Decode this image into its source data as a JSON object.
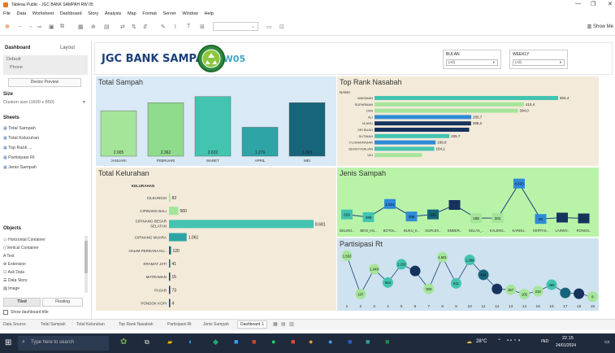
{
  "window": {
    "title": "Tableau Public - JGC BANK SAMPAH RW 05",
    "controls": [
      "—",
      "❐",
      "✕"
    ]
  },
  "menu": [
    "File",
    "Data",
    "Worksheet",
    "Dashboard",
    "Story",
    "Analysis",
    "Map",
    "Format",
    "Server",
    "Window",
    "Help"
  ],
  "toolbar": {
    "show_me": "Show Me"
  },
  "left": {
    "tab_dashboard": "Dashboard",
    "tab_layout": "Layout",
    "device_default": "Default",
    "device_phone": "Phone",
    "device_preview": "Device Preview",
    "size_heading": "Size",
    "size_value": "Custom size (1600 x 850)",
    "sheets_heading": "Sheets",
    "sheets": [
      "Total Sampah",
      "Total Keluruhan",
      "Top Rank ...",
      "Partisipasi Rt",
      "Jenis Sampah"
    ],
    "objects_heading": "Objects",
    "objects": [
      "Horizontal Container",
      "Vertical Container",
      "Text",
      "Extension",
      "Ask Data",
      "Data Story",
      "Image"
    ],
    "tiled": "Tiled",
    "floating": "Floating",
    "show_title": "Show dashboard title"
  },
  "dashboard": {
    "title": "JGC BANK SAMPAH",
    "title_suffix": "RW05",
    "filters": [
      {
        "label": "BULAN",
        "value": "(All)"
      },
      {
        "label": "WEEKLY",
        "value": "(All)"
      }
    ]
  },
  "colors": {
    "teal_dark": "#17657b",
    "teal": "#43c4b0",
    "green_light": "#a5e59a",
    "navy": "#16335e",
    "blue": "#2e8bd6",
    "panel_blue": "#d9e9f5",
    "panel_tan": "#f3ead9",
    "panel_green": "#b9f3a8",
    "panel_ltblue": "#cfe2ef"
  },
  "chart_data": [
    {
      "id": "total_sampah",
      "type": "bar",
      "title": "Total Sampah",
      "categories": [
        "JANUARI",
        "FEBRUARI",
        "MARET",
        "APRIL",
        "MEI"
      ],
      "values": [
        2005,
        2362,
        2632,
        1276,
        2363
      ],
      "labels": [
        "2.005",
        "2.362",
        "2.632",
        "1.276",
        "2.363"
      ],
      "colors": [
        "#a5e59a",
        "#8fdc8c",
        "#43c4b0",
        "#2ea4a6",
        "#17657b"
      ]
    },
    {
      "id": "top_rank",
      "type": "bar",
      "orientation": "horizontal",
      "title": "Top Rank Nasabah",
      "dimension_label": "NAMA",
      "categories": [
        "WAKIMAN",
        "SUPARMAN",
        "DWI",
        "ALI",
        "M.ARU",
        "SRI BUAH",
        "SUTINAH",
        "FLORIA/PASAR",
        "DENSY/GALIAN",
        "UKI"
      ],
      "values": [
        504.4,
        410.4,
        394.0,
        265.7,
        265.2,
        260.0,
        205.7,
        168.0,
        164.1,
        130.0
      ],
      "labels": [
        "504,4",
        "410,4",
        "394,0",
        "265,7",
        "265,2",
        "",
        "205,7",
        "168,0",
        "164,1",
        ""
      ],
      "colors": [
        "#43c4b0",
        "#a5e59a",
        "#a5e59a",
        "#2e8bd6",
        "#16335e",
        "#16335e",
        "#43c4b0",
        "#2e8bd6",
        "#43c4b0",
        "#a5e59a"
      ]
    },
    {
      "id": "total_kelurahan",
      "type": "bar",
      "orientation": "horizontal",
      "title": "Total Kelurahan",
      "dimension_label": "KELURAHAN",
      "categories": [
        "CILEUNGSI",
        "CIPINANG BALI",
        "CIPINANG BESAR SELATAN",
        "CIPINANG MUARA",
        "HALIM PERDANA KU..",
        "KRAMAT JATI",
        "MATRAMAN",
        "PASAR",
        "PONDOK KOPI"
      ],
      "values": [
        82,
        560,
        8681,
        1061,
        120,
        41,
        15,
        73,
        4
      ],
      "labels": [
        "82",
        "560",
        "8.681",
        "1.061",
        "120",
        "41",
        "15",
        "73",
        "4"
      ],
      "colors": [
        "#a5e59a",
        "#a5e59a",
        "#43c4b0",
        "#2ea4a6",
        "#17657b",
        "#17657b",
        "#16335e",
        "#16335e",
        "#16335e"
      ]
    },
    {
      "id": "jenis_sampah",
      "type": "line",
      "title": "Jenis Sampah",
      "categories": [
        "BELING..",
        "BESI_KG..",
        "BOTOL..",
        "BUKU_K..",
        "DUPLEX..",
        "EMBER..",
        "GELAS_..",
        "KALENG..",
        "KARDU..",
        "KERTAS..",
        "LAINNY..",
        "RONGS.."
      ],
      "values": [
        629,
        299,
        1924,
        388,
        636,
        1800,
        188,
        201,
        4433,
        80,
        250,
        150
      ],
      "labels": [
        "629",
        "299",
        "1.924",
        "388",
        "636",
        "",
        "188",
        "201",
        "4.433",
        "80",
        "",
        ""
      ],
      "colors": [
        "#43c4b0",
        "#43c4b0",
        "#2e8bd6",
        "#2e8bd6",
        "#17657b",
        "#16335e",
        "#a5e59a",
        "#a5e59a",
        "#2e8bd6",
        "#2e8bd6",
        "#16335e",
        "#16335e"
      ]
    },
    {
      "id": "partisipasi_rt",
      "type": "line",
      "title": "Partisipasi Rt",
      "categories": [
        "1",
        "2",
        "3",
        "4",
        "5",
        "6",
        "7",
        "8",
        "9",
        "10",
        "11",
        "12",
        "13",
        "14",
        "15",
        "16",
        "17",
        "18",
        "19"
      ],
      "values": [
        1553,
        107,
        1049,
        544,
        1233,
        980,
        303,
        1501,
        511,
        1399,
        834,
        300,
        267,
        105,
        216,
        460,
        150,
        120,
        8
      ],
      "labels": [
        "1.553",
        "107",
        "1.049",
        "544",
        "1.233",
        "",
        "303",
        "1.501",
        "511",
        "1.399",
        "834",
        "",
        "267",
        "105",
        "216",
        "460",
        "",
        "",
        "8"
      ],
      "colors": [
        "#a5e59a",
        "#a5e59a",
        "#a5e59a",
        "#43c4b0",
        "#43c4b0",
        "#16335e",
        "#a5e59a",
        "#a5e59a",
        "#43c4b0",
        "#43c4b0",
        "#17657b",
        "#16335e",
        "#a5e59a",
        "#a5e59a",
        "#a5e59a",
        "#43c4b0",
        "#17657b",
        "#16335e",
        "#a5e59a"
      ]
    }
  ],
  "bottom_tabs": [
    "Data Source",
    "Total Sampah",
    "Total Keluruhan",
    "Top Rank Nasabah",
    "Partisipasi Rt",
    "Jenis Sampah",
    "Dashboard 1"
  ],
  "taskbar": {
    "search_placeholder": "Type here to search",
    "weather": "28°C",
    "lang": "IND",
    "time": "22.15",
    "date": "24/01/2024"
  }
}
